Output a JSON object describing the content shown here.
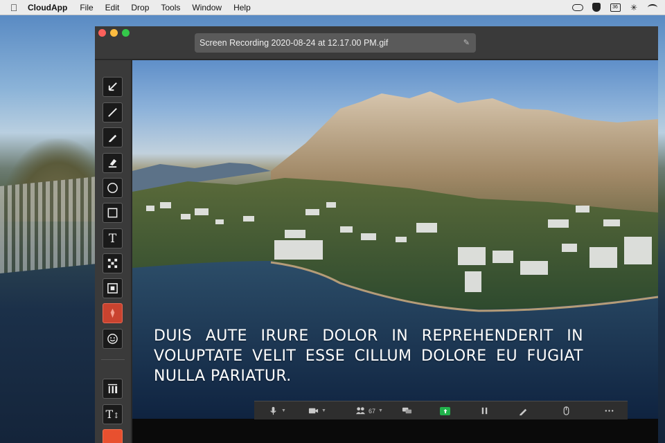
{
  "menubar": {
    "apple_icon": "apple-logo-icon",
    "app_name": "CloudApp",
    "items": [
      "File",
      "Edit",
      "Drop",
      "Tools",
      "Window",
      "Help"
    ],
    "status_icons": [
      "cloudapp-icon",
      "shield-icon",
      "calendar-icon",
      "bluetooth-icon",
      "wifi-icon"
    ],
    "calendar_day": "36"
  },
  "window": {
    "filename": "Screen Recording 2020-08-24 at 12.17.00 PM.gif",
    "traffic_colors": {
      "close": "#fc605b",
      "minimize": "#fdbc40",
      "maximize": "#34c84a"
    }
  },
  "toolbar": {
    "tools": [
      {
        "name": "arrow-tool",
        "icon": "arrow-icon"
      },
      {
        "name": "line-tool",
        "icon": "line-icon"
      },
      {
        "name": "pen-tool",
        "icon": "pen-icon"
      },
      {
        "name": "highlighter-tool",
        "icon": "highlighter-icon"
      },
      {
        "name": "ellipse-tool",
        "icon": "ellipse-icon"
      },
      {
        "name": "rectangle-tool",
        "icon": "rectangle-icon"
      },
      {
        "name": "text-tool",
        "icon": "text-icon",
        "label": "T"
      },
      {
        "name": "pixelate-tool",
        "icon": "pixelate-icon"
      },
      {
        "name": "spotlight-tool",
        "icon": "spotlight-icon"
      },
      {
        "name": "step-marker-tool",
        "icon": "marker-icon"
      },
      {
        "name": "emoji-tool",
        "icon": "smiley-icon"
      },
      {
        "name": "line-width-button",
        "icon": "line-width-icon"
      },
      {
        "name": "text-size-button",
        "icon": "text-size-icon",
        "label": "T"
      },
      {
        "name": "color-swatch-button",
        "icon": "color-swatch"
      }
    ],
    "accent_color": "#e8502f"
  },
  "canvas": {
    "caption": "Duis aute irure dolor in reprehenderit in voluptate velit esse cillum dolore eu fugiat nulla pariatur."
  },
  "controlbar": {
    "items": [
      {
        "name": "microphone-button",
        "icon": "microphone-icon"
      },
      {
        "name": "video-button",
        "icon": "video-camera-icon"
      },
      {
        "name": "participants-button",
        "icon": "participants-icon",
        "count": "67"
      },
      {
        "name": "chat-button",
        "icon": "chat-icon"
      },
      {
        "name": "share-screen-button",
        "icon": "share-screen-icon"
      },
      {
        "name": "pause-button",
        "icon": "pause-icon"
      },
      {
        "name": "annotate-button",
        "icon": "pencil-icon"
      },
      {
        "name": "mouse-button",
        "icon": "mouse-icon"
      },
      {
        "name": "more-button",
        "icon": "more-icon"
      }
    ],
    "share_color": "#21b24b"
  }
}
